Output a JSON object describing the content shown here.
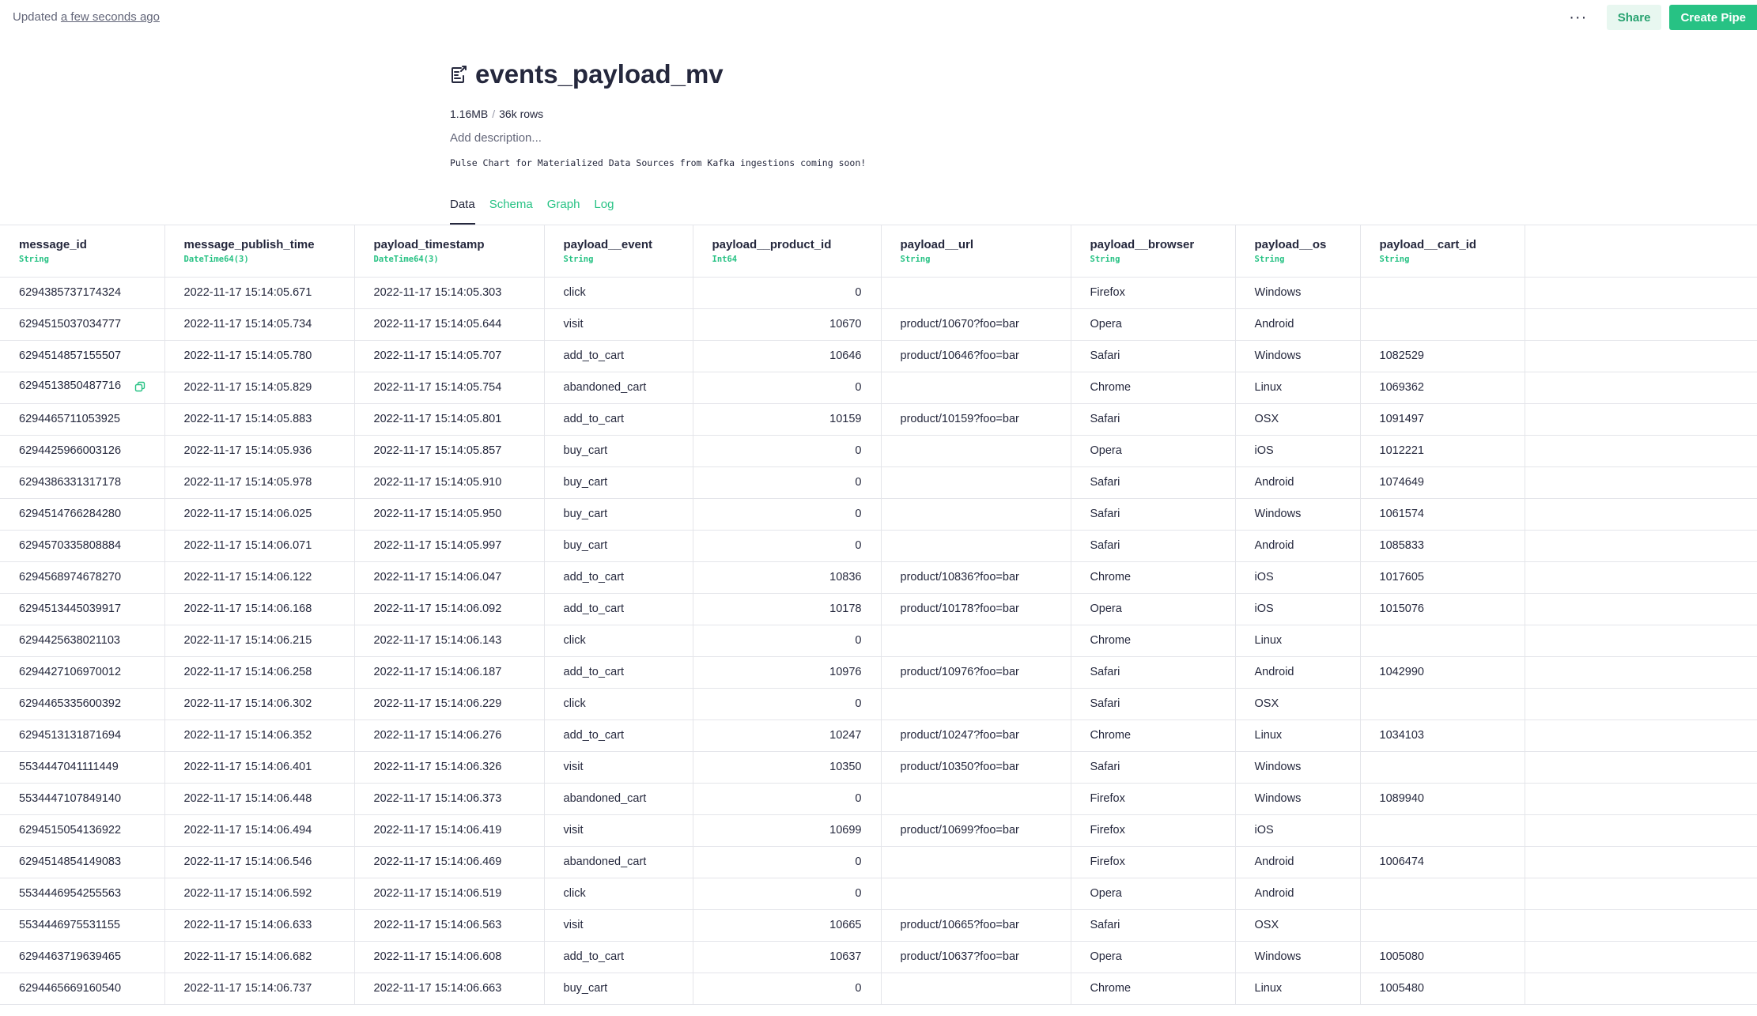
{
  "topbar": {
    "updated_prefix": "Updated",
    "updated_link": "a few seconds ago",
    "more_label": "···",
    "share_label": "Share",
    "create_label": "Create Pipe"
  },
  "header": {
    "title": "events_payload_mv",
    "size": "1.16MB",
    "rows": "36k rows",
    "separator": "/",
    "description_placeholder": "Add description...",
    "note": "Pulse Chart for Materialized Data Sources from Kafka ingestions coming soon!"
  },
  "tabs": [
    {
      "label": "Data",
      "active": true
    },
    {
      "label": "Schema",
      "active": false
    },
    {
      "label": "Graph",
      "active": false
    },
    {
      "label": "Log",
      "active": false
    }
  ],
  "table": {
    "columns": [
      {
        "name": "message_id",
        "type": "String"
      },
      {
        "name": "message_publish_time",
        "type": "DateTime64(3)"
      },
      {
        "name": "payload_timestamp",
        "type": "DateTime64(3)"
      },
      {
        "name": "payload__event",
        "type": "String"
      },
      {
        "name": "payload__product_id",
        "type": "Int64"
      },
      {
        "name": "payload__url",
        "type": "String"
      },
      {
        "name": "payload__browser",
        "type": "String"
      },
      {
        "name": "payload__os",
        "type": "String"
      },
      {
        "name": "payload__cart_id",
        "type": "String"
      }
    ],
    "rows": [
      [
        "6294385737174324",
        "2022-11-17 15:14:05.671",
        "2022-11-17 15:14:05.303",
        "click",
        "0",
        "",
        "Firefox",
        "Windows",
        ""
      ],
      [
        "6294515037034777",
        "2022-11-17 15:14:05.734",
        "2022-11-17 15:14:05.644",
        "visit",
        "10670",
        "product/10670?foo=bar",
        "Opera",
        "Android",
        ""
      ],
      [
        "6294514857155507",
        "2022-11-17 15:14:05.780",
        "2022-11-17 15:14:05.707",
        "add_to_cart",
        "10646",
        "product/10646?foo=bar",
        "Safari",
        "Windows",
        "1082529"
      ],
      [
        "6294513850487716",
        "2022-11-17 15:14:05.829",
        "2022-11-17 15:14:05.754",
        "abandoned_cart",
        "0",
        "",
        "Chrome",
        "Linux",
        "1069362"
      ],
      [
        "6294465711053925",
        "2022-11-17 15:14:05.883",
        "2022-11-17 15:14:05.801",
        "add_to_cart",
        "10159",
        "product/10159?foo=bar",
        "Safari",
        "OSX",
        "1091497"
      ],
      [
        "6294425966003126",
        "2022-11-17 15:14:05.936",
        "2022-11-17 15:14:05.857",
        "buy_cart",
        "0",
        "",
        "Opera",
        "iOS",
        "1012221"
      ],
      [
        "6294386331317178",
        "2022-11-17 15:14:05.978",
        "2022-11-17 15:14:05.910",
        "buy_cart",
        "0",
        "",
        "Safari",
        "Android",
        "1074649"
      ],
      [
        "6294514766284280",
        "2022-11-17 15:14:06.025",
        "2022-11-17 15:14:05.950",
        "buy_cart",
        "0",
        "",
        "Safari",
        "Windows",
        "1061574"
      ],
      [
        "6294570335808884",
        "2022-11-17 15:14:06.071",
        "2022-11-17 15:14:05.997",
        "buy_cart",
        "0",
        "",
        "Safari",
        "Android",
        "1085833"
      ],
      [
        "6294568974678270",
        "2022-11-17 15:14:06.122",
        "2022-11-17 15:14:06.047",
        "add_to_cart",
        "10836",
        "product/10836?foo=bar",
        "Chrome",
        "iOS",
        "1017605"
      ],
      [
        "6294513445039917",
        "2022-11-17 15:14:06.168",
        "2022-11-17 15:14:06.092",
        "add_to_cart",
        "10178",
        "product/10178?foo=bar",
        "Opera",
        "iOS",
        "1015076"
      ],
      [
        "6294425638021103",
        "2022-11-17 15:14:06.215",
        "2022-11-17 15:14:06.143",
        "click",
        "0",
        "",
        "Chrome",
        "Linux",
        ""
      ],
      [
        "6294427106970012",
        "2022-11-17 15:14:06.258",
        "2022-11-17 15:14:06.187",
        "add_to_cart",
        "10976",
        "product/10976?foo=bar",
        "Safari",
        "Android",
        "1042990"
      ],
      [
        "6294465335600392",
        "2022-11-17 15:14:06.302",
        "2022-11-17 15:14:06.229",
        "click",
        "0",
        "",
        "Safari",
        "OSX",
        ""
      ],
      [
        "6294513131871694",
        "2022-11-17 15:14:06.352",
        "2022-11-17 15:14:06.276",
        "add_to_cart",
        "10247",
        "product/10247?foo=bar",
        "Chrome",
        "Linux",
        "1034103"
      ],
      [
        "5534447041111449",
        "2022-11-17 15:14:06.401",
        "2022-11-17 15:14:06.326",
        "visit",
        "10350",
        "product/10350?foo=bar",
        "Safari",
        "Windows",
        ""
      ],
      [
        "5534447107849140",
        "2022-11-17 15:14:06.448",
        "2022-11-17 15:14:06.373",
        "abandoned_cart",
        "0",
        "",
        "Firefox",
        "Windows",
        "1089940"
      ],
      [
        "6294515054136922",
        "2022-11-17 15:14:06.494",
        "2022-11-17 15:14:06.419",
        "visit",
        "10699",
        "product/10699?foo=bar",
        "Firefox",
        "iOS",
        ""
      ],
      [
        "6294514854149083",
        "2022-11-17 15:14:06.546",
        "2022-11-17 15:14:06.469",
        "abandoned_cart",
        "0",
        "",
        "Firefox",
        "Android",
        "1006474"
      ],
      [
        "5534446954255563",
        "2022-11-17 15:14:06.592",
        "2022-11-17 15:14:06.519",
        "click",
        "0",
        "",
        "Opera",
        "Android",
        ""
      ],
      [
        "5534446975531155",
        "2022-11-17 15:14:06.633",
        "2022-11-17 15:14:06.563",
        "visit",
        "10665",
        "product/10665?foo=bar",
        "Safari",
        "OSX",
        ""
      ],
      [
        "6294463719639465",
        "2022-11-17 15:14:06.682",
        "2022-11-17 15:14:06.608",
        "add_to_cart",
        "10637",
        "product/10637?foo=bar",
        "Opera",
        "Windows",
        "1005080"
      ],
      [
        "6294465669160540",
        "2022-11-17 15:14:06.737",
        "2022-11-17 15:14:06.663",
        "buy_cart",
        "0",
        "",
        "Chrome",
        "Linux",
        "1005480"
      ]
    ]
  },
  "icons": {
    "title_icon": "materialized-datasource-icon",
    "copy_icon": "copy-icon"
  },
  "colors": {
    "accent": "#27c284",
    "text": "#25283d",
    "muted": "#636679",
    "border": "#e4e5ea"
  }
}
